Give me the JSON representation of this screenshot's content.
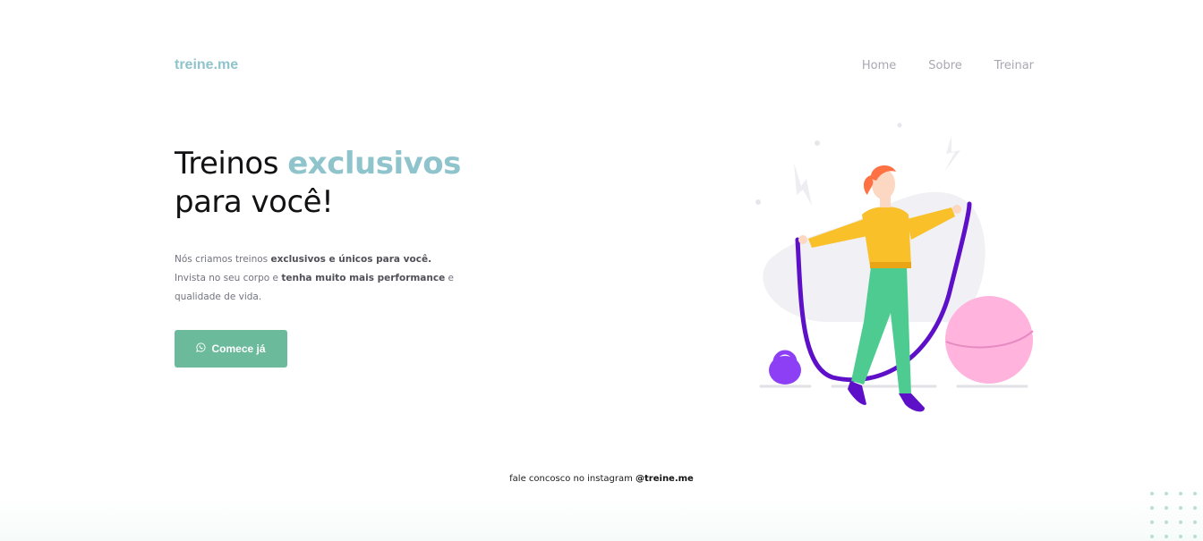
{
  "brand": {
    "logo": "treine.me"
  },
  "nav": {
    "items": [
      "Home",
      "Sobre",
      "Treinar"
    ]
  },
  "hero": {
    "title_part1": "Treinos ",
    "title_accent": "exclusivos",
    "title_part2": "para você!",
    "desc_line1_a": "Nós criamos treinos ",
    "desc_line1_b": "exclusivos e únicos para você.",
    "desc_line2_a": "Invista no seu corpo e ",
    "desc_line2_b": "tenha muito mais performance",
    "desc_line2_c": " e",
    "desc_line3": "qualidade de vida."
  },
  "cta": {
    "label": "Comece já",
    "icon": "whatsapp-icon"
  },
  "illustration": {
    "subject": "woman-jumping-rope-icon"
  },
  "footer": {
    "text": "fale concosco no instagram ",
    "handle": "@treine.me"
  },
  "colors": {
    "accent": "#8fc4cc",
    "button": "#6cba9c",
    "text_dark": "#121214",
    "text_muted": "#737380",
    "nav": "#a8a8b3"
  }
}
